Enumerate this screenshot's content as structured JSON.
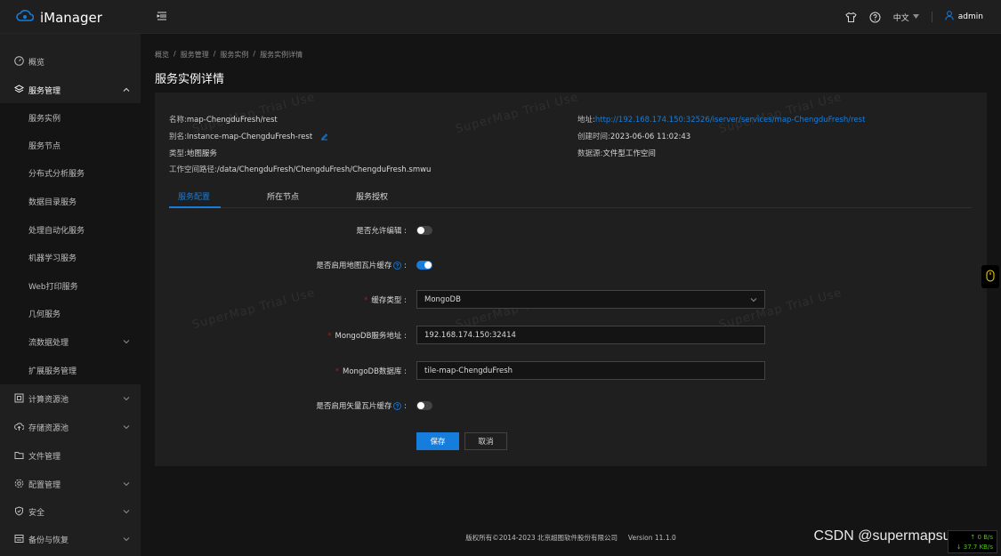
{
  "app": {
    "brand": "iManager"
  },
  "header": {
    "language": "中文",
    "user": "admin"
  },
  "sidebar": {
    "items": [
      {
        "label": "概览",
        "icon": "gauge-icon"
      },
      {
        "label": "服务管理",
        "icon": "layers-icon",
        "active": true
      },
      {
        "label": "计算资源池",
        "icon": "compute-icon"
      },
      {
        "label": "存储资源池",
        "icon": "cloud-upload-icon"
      },
      {
        "label": "文件管理",
        "icon": "folder-icon"
      },
      {
        "label": "配置管理",
        "icon": "gear-icon"
      },
      {
        "label": "安全",
        "icon": "shield-icon"
      },
      {
        "label": "备份与恢复",
        "icon": "backup-icon"
      }
    ],
    "submenu": [
      {
        "label": "服务实例"
      },
      {
        "label": "服务节点"
      },
      {
        "label": "分布式分析服务"
      },
      {
        "label": "数据目录服务"
      },
      {
        "label": "处理自动化服务"
      },
      {
        "label": "机器学习服务"
      },
      {
        "label": "Web打印服务"
      },
      {
        "label": "几何服务"
      },
      {
        "label": "流数据处理",
        "expandable": true
      },
      {
        "label": "扩展服务管理"
      }
    ]
  },
  "breadcrumb": [
    "概览",
    "/",
    "服务管理",
    "/",
    "服务实例",
    "/",
    "服务实例详情"
  ],
  "page": {
    "title": "服务实例详情"
  },
  "details": {
    "name_k": "名称:",
    "name_v": "map-ChengduFresh/rest",
    "alias_k": "别名:",
    "alias_v": "Instance-map-ChengduFresh-rest",
    "type_k": "类型:",
    "type_v": "地图服务",
    "path_k": "工作空间路径:",
    "path_v": "/data/ChengduFresh/ChengduFresh/ChengduFresh.smwu",
    "addr_k": "地址:",
    "addr_v": "http://192.168.174.150:32526/iserver/services/map-ChengduFresh/rest",
    "created_k": "创建时间:",
    "created_v": "2023-06-06 11:02:43",
    "source_k": "数据源:",
    "source_v": "文件型工作空间"
  },
  "tabs": [
    "服务配置",
    "所在节点",
    "服务授权"
  ],
  "form": {
    "allow_edit": {
      "label": "是否允许编辑",
      "colon": ":",
      "on": false
    },
    "tile_cache": {
      "label": "是否启用地图瓦片缓存",
      "colon": ":",
      "on": true
    },
    "cache_type": {
      "label": "缓存类型",
      "colon": ":",
      "value": "MongoDB"
    },
    "mongo_addr": {
      "label": "MongoDB服务地址",
      "colon": ":",
      "value": "192.168.174.150:32414"
    },
    "mongo_db": {
      "label": "MongoDB数据库",
      "colon": ":",
      "value": "tile-map-ChengduFresh"
    },
    "vector_cache": {
      "label": "是否启用矢量瓦片缓存",
      "colon": ":",
      "on": false
    },
    "save": "保存",
    "cancel": "取消"
  },
  "watermark": "SuperMap Trial Use",
  "footer": {
    "copyright": "版权所有©2014-2023 北京超图软件股份有限公司",
    "version": "Version 11.1.0"
  },
  "overlay": {
    "csdn": "CSDN @supermapsupport",
    "net_up": "↑ 0 B/s",
    "net_down": "↓ 37.7 KB/s"
  },
  "colors": {
    "accent": "#177ddc",
    "background": "#141414",
    "panel": "#1f1f1f",
    "required": "#a61d24"
  }
}
